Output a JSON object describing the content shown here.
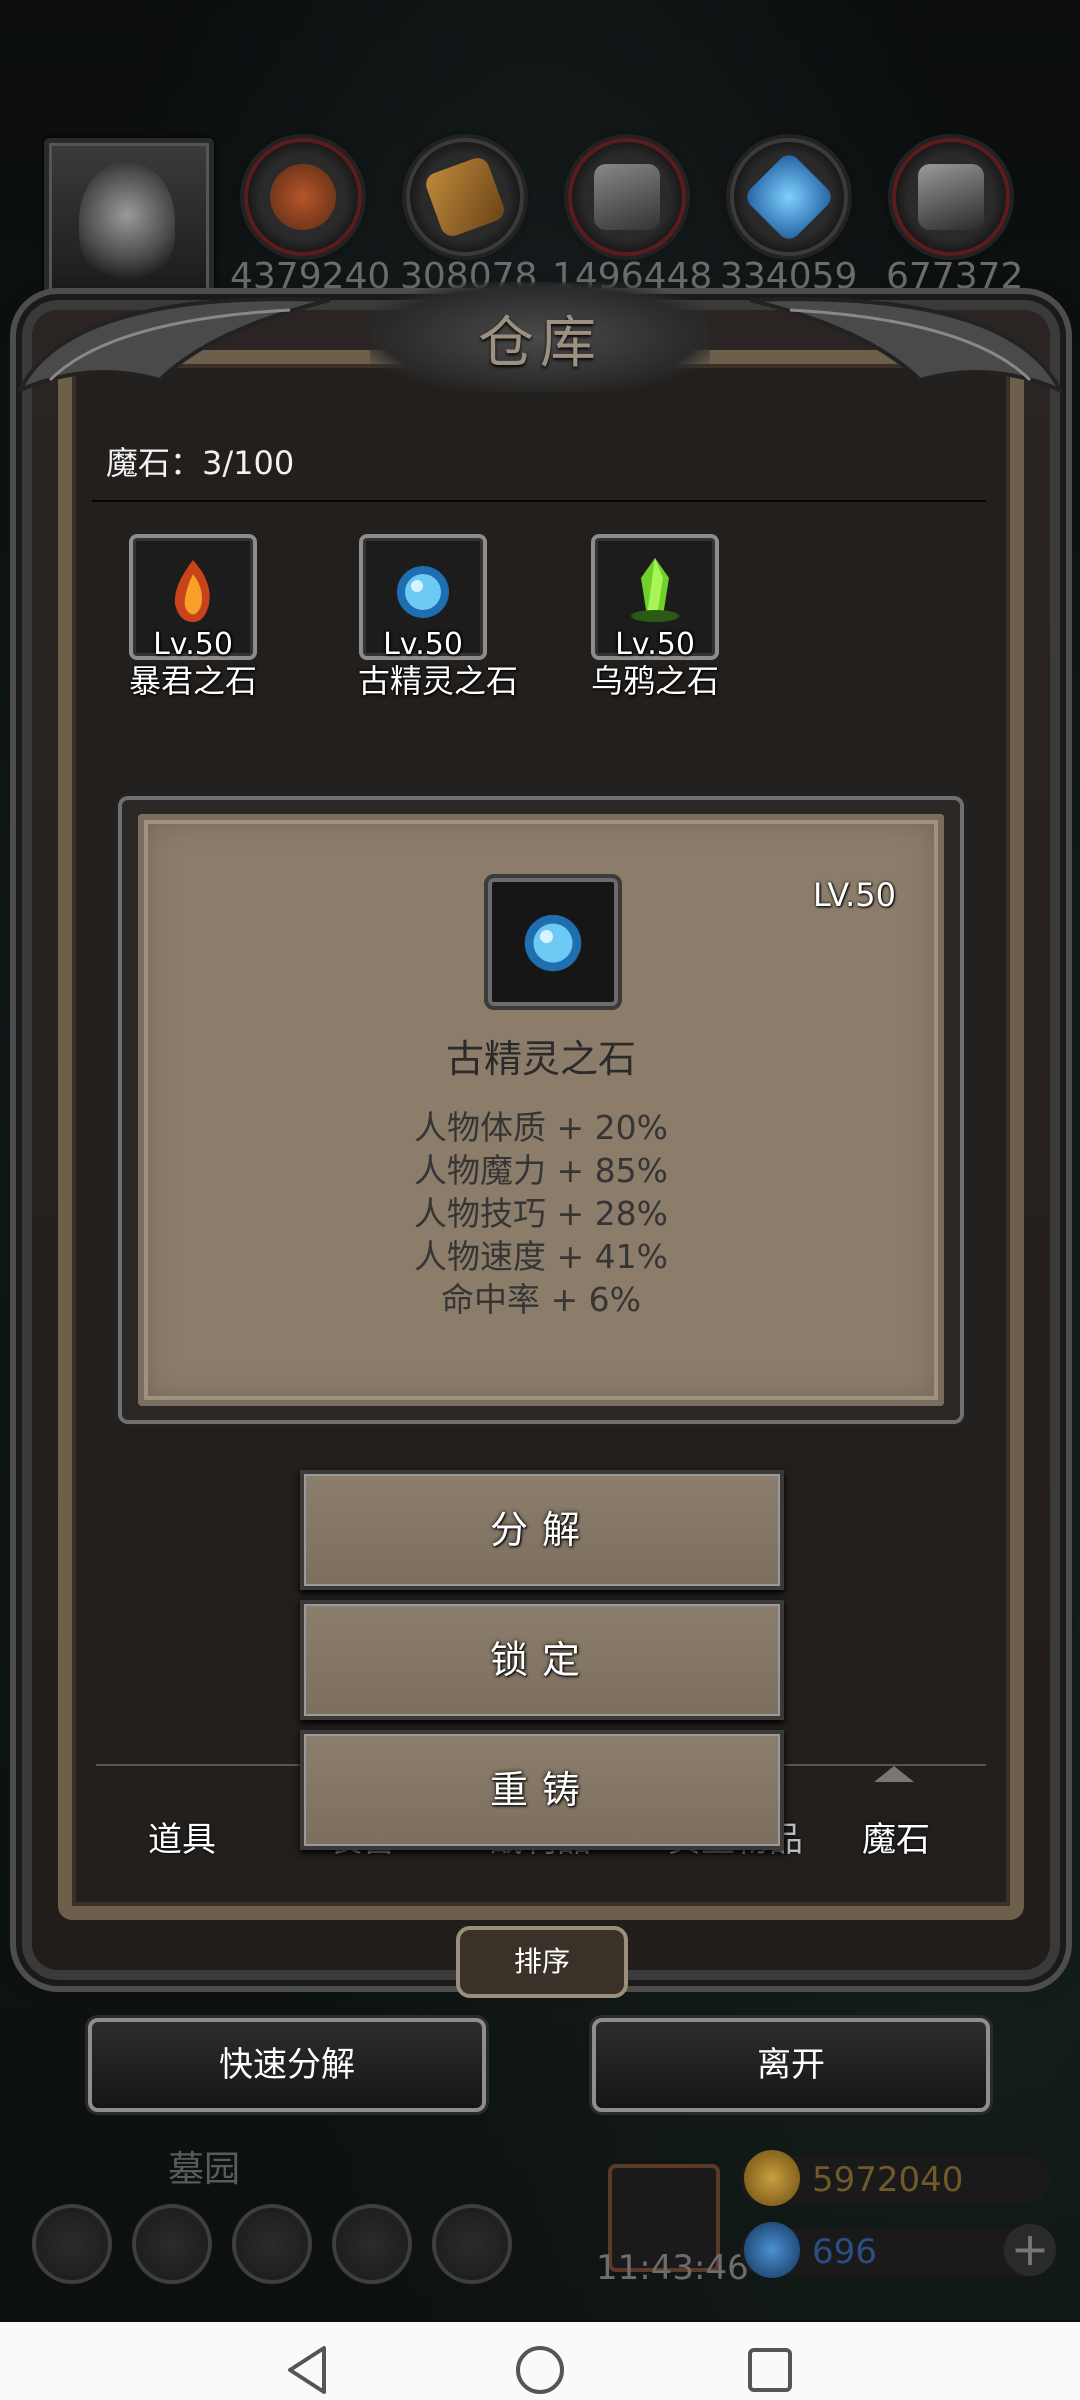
{
  "top_bar": {
    "resources": [
      {
        "name": "ore-icon",
        "value": "4379240"
      },
      {
        "name": "wood-icon",
        "value": "308078"
      },
      {
        "name": "iron-icon",
        "value": "1496448"
      },
      {
        "name": "crystal-icon",
        "value": "334059"
      },
      {
        "name": "steel-icon",
        "value": "677372"
      }
    ]
  },
  "warehouse": {
    "title": "仓库",
    "count_label": "魔石：3/100",
    "stones": [
      {
        "name": "暴君之石",
        "level": "Lv.50",
        "icon": "fire-stone-icon"
      },
      {
        "name": "古精灵之石",
        "level": "Lv.50",
        "icon": "blue-orb-stone-icon"
      },
      {
        "name": "乌鸦之石",
        "level": "Lv.50",
        "icon": "green-crystal-stone-icon"
      }
    ],
    "detail": {
      "level": "LV.50",
      "name": "古精灵之石",
      "stats": [
        "人物体质 + 20%",
        "人物魔力 + 85%",
        "人物技巧 + 28%",
        "人物速度 + 41%",
        "命中率 + 6%"
      ]
    },
    "actions": {
      "decompose": "分解",
      "lock": "锁定",
      "reforge": "重铸"
    },
    "tabs": [
      "道具",
      "装备",
      "战利品",
      "贵重物品",
      "魔石"
    ],
    "sort": "排序"
  },
  "buttons": {
    "quick_decompose": "快速分解",
    "leave": "离开"
  },
  "hud": {
    "map_name": "墓园",
    "clock": "11:43:46",
    "gold": "5972040",
    "gems": "696",
    "colors": {
      "gold": "#8a6a1a",
      "gems": "#1e4f8c"
    }
  }
}
